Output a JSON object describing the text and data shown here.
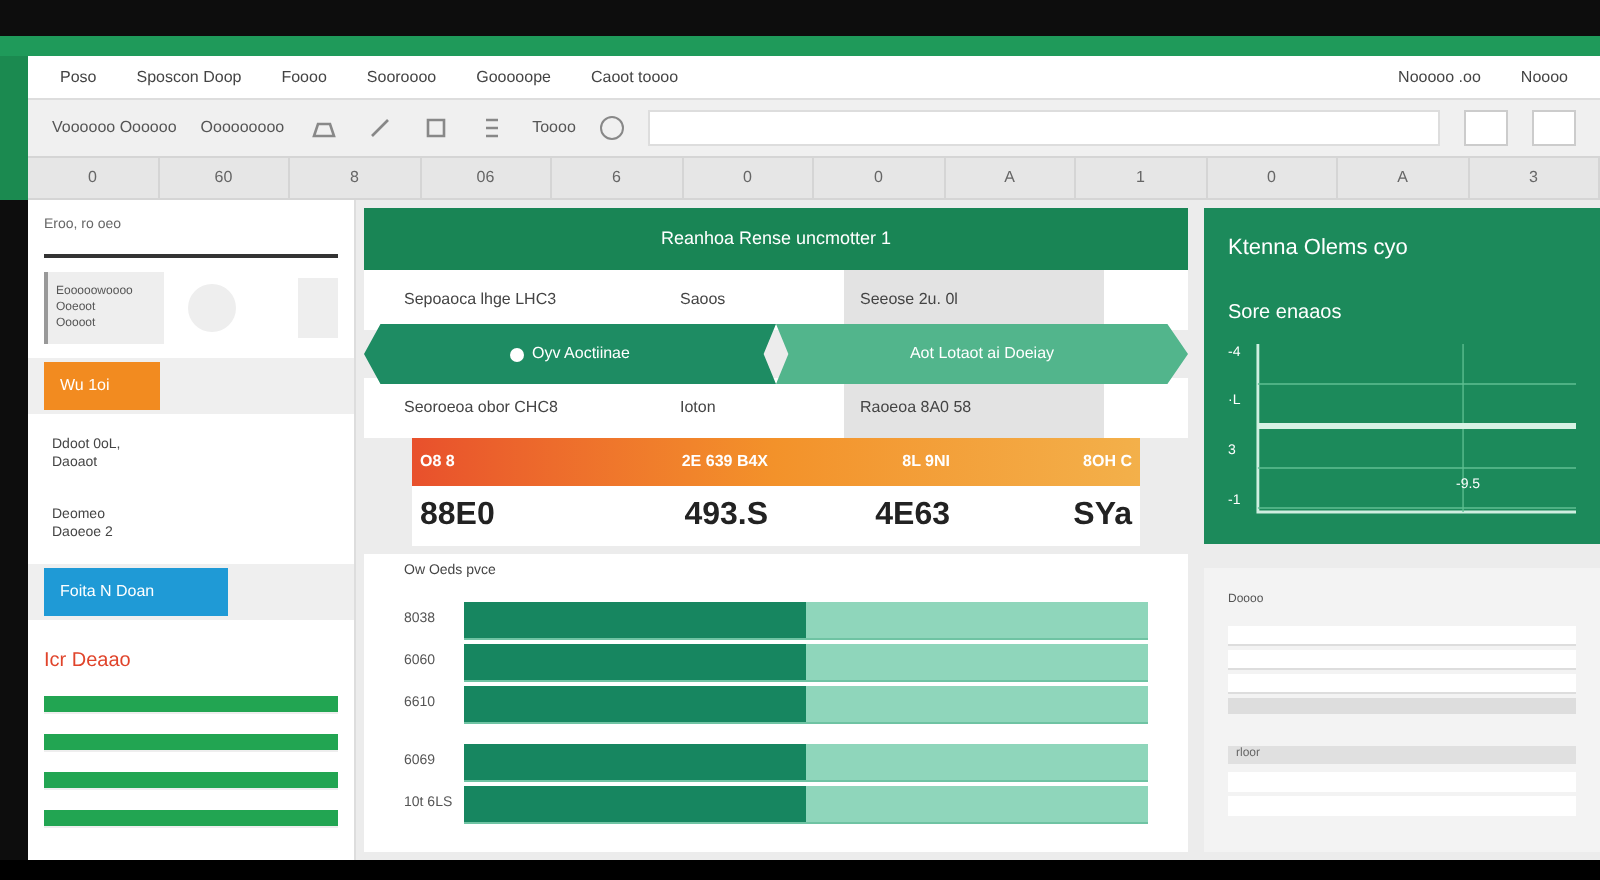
{
  "ribbon": {
    "menu": [
      {
        "label": "Poso"
      },
      {
        "label": "Sposcon Doop"
      },
      {
        "label": "Foooo"
      },
      {
        "label": "Sooroooo"
      },
      {
        "label": "Gooooope"
      },
      {
        "label": "Caoot toooo"
      }
    ],
    "right_menu": [
      {
        "label": "Nooooo .oo"
      },
      {
        "label": "Noooo"
      }
    ],
    "toolbar": [
      {
        "label": "Voooooo Oooooo"
      },
      {
        "label": "Ooooooooo"
      },
      {
        "label": "Toooo"
      }
    ],
    "column_headers": [
      "0",
      "60",
      "8",
      "06",
      "6",
      "0",
      "0",
      "A",
      "1",
      "0",
      "A",
      "3"
    ]
  },
  "left_panel": {
    "title": "Eroo, ro oeo",
    "card": [
      "Eooooowoooo",
      "Ooeoot",
      "Ooooot"
    ],
    "items": [
      {
        "kind": "button",
        "label": "Wu 1oi",
        "color": "#f28b20"
      },
      {
        "kind": "pill",
        "label": "Ddoot 0oL,",
        "sub": "Daoaot"
      },
      {
        "kind": "pill",
        "label": "Deomeo",
        "sub": "Daoeoe 2"
      },
      {
        "kind": "button",
        "label": "Foita N Doan",
        "color": "#1f9ad6"
      }
    ],
    "section": "Icr Deaao"
  },
  "main": {
    "header": "Reanhoa Rense uncmotter 1",
    "row_1": [
      "Sepoaoca lhge LHC3",
      "Saoos",
      "Seeose 2u. 0l"
    ],
    "steps": [
      {
        "label": "Oyv Aoctiinae",
        "selected": true
      },
      {
        "label": "Aot Lotaot ai Doeiay",
        "selected": false
      }
    ],
    "row_2": [
      "Seoroeoa obor CHC8",
      "Ioton",
      "Raoeoa 8A0 58"
    ],
    "totals": [
      {
        "label": "O8 8",
        "value": "88E0"
      },
      {
        "label": "2E 639 B4X",
        "value": "493.S"
      },
      {
        "label": "8L 9NI",
        "value": "4E63"
      },
      {
        "label": "8OH C",
        "value": "SYa"
      }
    ],
    "bars_title": "Ow Oeds pvce",
    "bars": [
      {
        "label": "8038",
        "level": 0.5
      },
      {
        "label": "6060",
        "level": 0.5
      },
      {
        "label": "6610",
        "level": 0.5
      },
      {
        "label": "6069",
        "level": 0.5
      },
      {
        "label": "10t 6LS",
        "level": 0.5
      }
    ]
  },
  "right_panel": {
    "title": "Ktenna Olems cyo",
    "subtitle": "Sore enaaos",
    "y_labels": [
      "-4",
      "·L",
      "3",
      "-1"
    ],
    "x_label": "-9.5",
    "list_title": "Doooo",
    "list_title_2": "rloor"
  }
}
